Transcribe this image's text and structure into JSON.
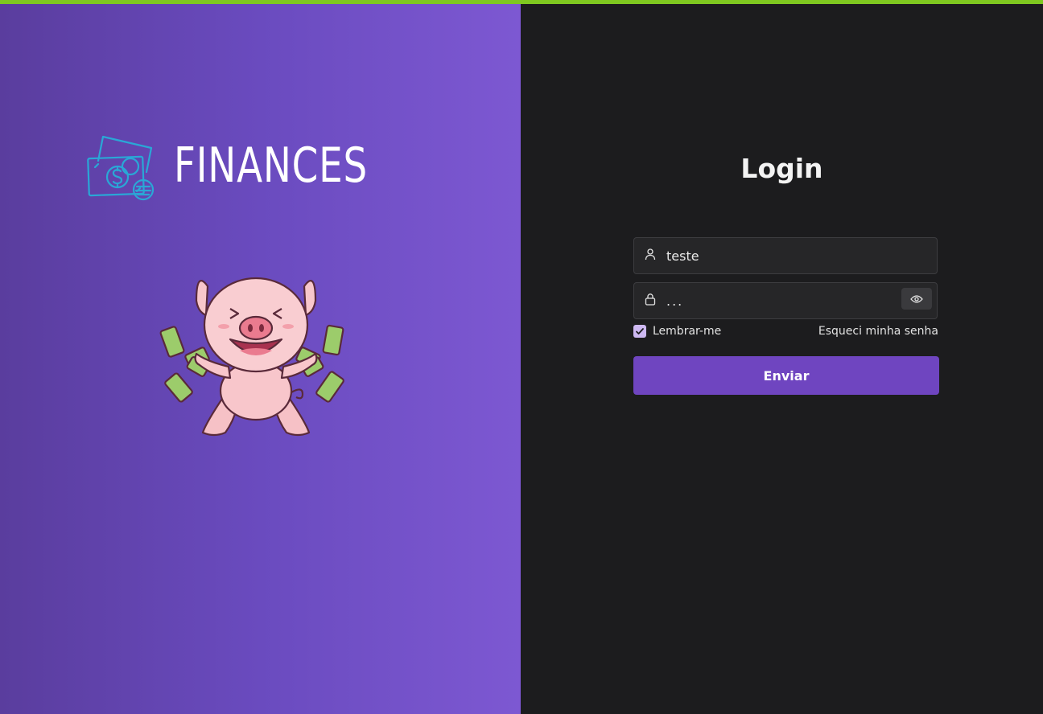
{
  "brand": {
    "name": "FINANCES",
    "logo_icon": "money-bills-and-coins-icon",
    "mascot": "happy-pig-with-money-illustration"
  },
  "colors": {
    "top_bar": "#7fc820",
    "left_gradient_start": "#5a3d9e",
    "left_gradient_end": "#7d58d2",
    "right_background": "#1c1c1e",
    "field_background": "#262628",
    "button": "#6f45c0",
    "logo_icon": "#2aa7d6"
  },
  "login": {
    "title": "Login",
    "username": {
      "icon": "user-icon",
      "value": "teste"
    },
    "password": {
      "icon": "lock-icon",
      "value": "...",
      "toggle_icon": "eye-icon"
    },
    "remember": {
      "label": "Lembrar-me",
      "checked": true
    },
    "forgot_label": "Esqueci minha senha",
    "submit_label": "Enviar"
  }
}
